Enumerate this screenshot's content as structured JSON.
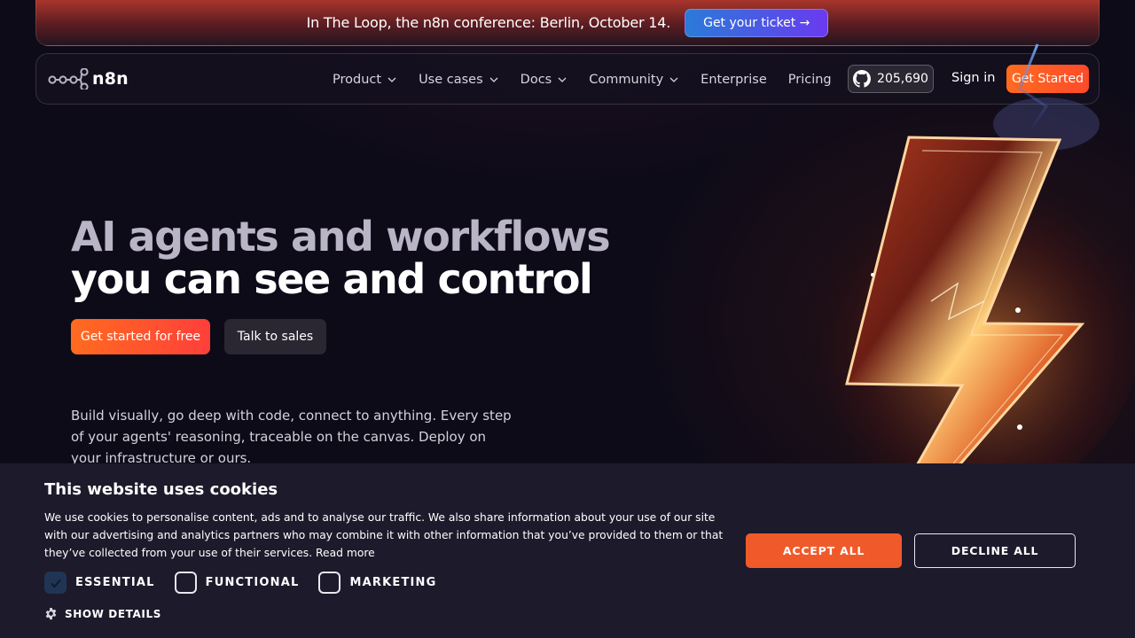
{
  "banner": {
    "text": "In The Loop, the n8n conference: Berlin, October 14.",
    "button_label": "Get your ticket →"
  },
  "nav": {
    "logo_text": "n8n",
    "items": [
      {
        "label": "Product",
        "has_dropdown": true
      },
      {
        "label": "Use cases",
        "has_dropdown": true
      },
      {
        "label": "Docs",
        "has_dropdown": true
      },
      {
        "label": "Community",
        "has_dropdown": true
      },
      {
        "label": "Enterprise",
        "has_dropdown": false
      },
      {
        "label": "Pricing",
        "has_dropdown": false
      }
    ],
    "github_stars": "205,690",
    "signin_label": "Sign in",
    "getstarted_label": "Get Started"
  },
  "hero": {
    "headline_line1": "AI agents and workflows",
    "headline_line2": "you can see and control",
    "cta_primary": "Get started for free",
    "cta_secondary": "Talk to sales",
    "description": "Build visually, go deep with code, connect to anything. Every step of your agents' reasoning, traceable on the canvas. Deploy on your infrastructure or ours."
  },
  "cookie": {
    "title": "This website uses cookies",
    "text": "We use cookies to personalise content, ads and to analyse our traffic. We also share information about your use of our site with our advertising and analytics partners who may combine it with other information that you’ve provided to them or that they’ve collected from your use of their services.",
    "read_more": "Read more",
    "options": [
      {
        "label": "ESSENTIAL",
        "checked": true
      },
      {
        "label": "FUNCTIONAL",
        "checked": false
      },
      {
        "label": "MARKETING",
        "checked": false
      }
    ],
    "show_details": "SHOW DETAILS",
    "accept_label": "ACCEPT ALL",
    "decline_label": "DECLINE ALL"
  },
  "colors": {
    "accent_orange": "#ff5a1f",
    "ticket_blue": "#2a7bd8",
    "ticket_purple": "#6a3af0",
    "background": "#0e0b18",
    "cookie_bg": "#1d1a2b",
    "accept_bg": "#f05a2a"
  }
}
